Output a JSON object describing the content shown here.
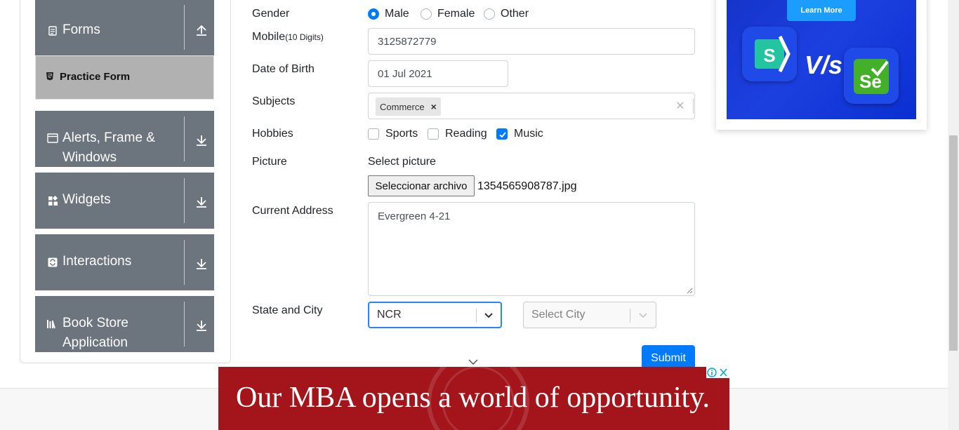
{
  "sidebar": {
    "groups": [
      {
        "label": "Forms",
        "icon": "document-icon"
      },
      {
        "label": "Alerts, Frame & Windows",
        "icon": "window-icon"
      },
      {
        "label": "Widgets",
        "icon": "widgets-icon"
      },
      {
        "label": "Interactions",
        "icon": "interactions-icon"
      },
      {
        "label": "Book Store Application",
        "icon": "books-icon"
      }
    ],
    "active_item": "Practice Form"
  },
  "form": {
    "gender_label": "Gender",
    "gender_options": [
      "Male",
      "Female",
      "Other"
    ],
    "gender_selected": "Male",
    "mobile_label": "Mobile",
    "mobile_hint": "(10 Digits)",
    "mobile_value": "3125872779",
    "dob_label": "Date of Birth",
    "dob_value": "01 Jul 2021",
    "subjects_label": "Subjects",
    "subjects": [
      "Commerce"
    ],
    "subjects_clear": "×",
    "hobbies_label": "Hobbies",
    "hobbies": [
      {
        "label": "Sports",
        "checked": false
      },
      {
        "label": "Reading",
        "checked": false
      },
      {
        "label": "Music",
        "checked": true
      }
    ],
    "picture_label": "Picture",
    "picture_prompt": "Select picture",
    "file_button": "Seleccionar archivo",
    "file_name": "1354565908787.jpg",
    "address_label": "Current Address",
    "address_value": "Evergreen 4-21",
    "state_city_label": "State and City",
    "state_value": "NCR",
    "city_placeholder": "Select City",
    "submit": "Submit"
  },
  "ads": {
    "top_button": "Learn More",
    "top_vs": "V/s",
    "bottom_text": "Our MBA opens a world of opportunity."
  },
  "colors": {
    "sidebar_group": "#6c757d",
    "active_item": "#b1b1b1",
    "primary": "#007bff",
    "ad_red": "#a3151b"
  }
}
